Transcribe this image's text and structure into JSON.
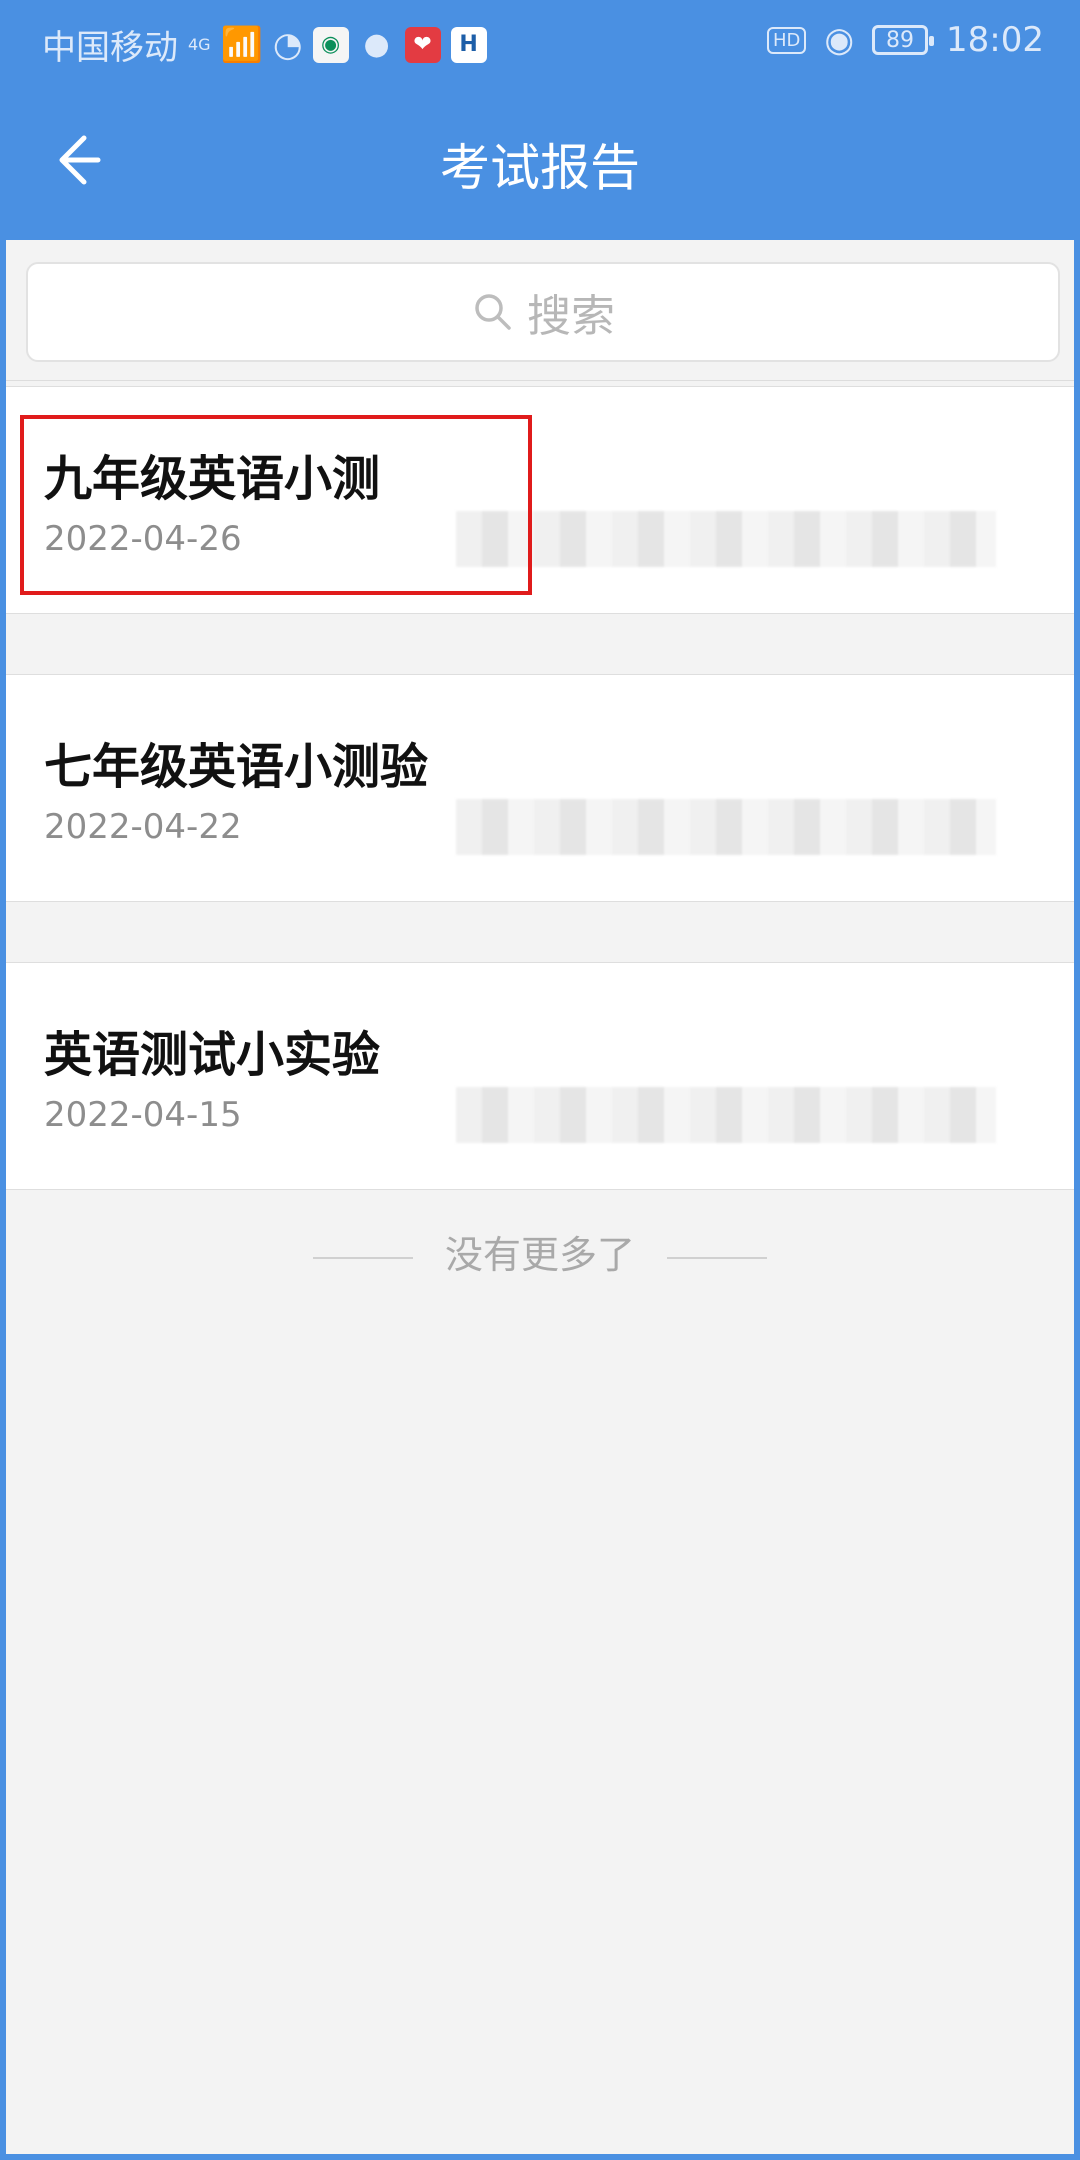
{
  "status": {
    "carrier": "中国移动",
    "network": "4G",
    "battery": "89",
    "hd": "HD",
    "time": "18:02"
  },
  "header": {
    "title": "考试报告"
  },
  "search": {
    "placeholder": "搜索"
  },
  "reports": [
    {
      "title": "九年级英语小测",
      "date": "2022-04-26"
    },
    {
      "title": "七年级英语小测验",
      "date": "2022-04-22"
    },
    {
      "title": "英语测试小实验",
      "date": "2022-04-15"
    }
  ],
  "footer": {
    "no_more": "没有更多了"
  }
}
